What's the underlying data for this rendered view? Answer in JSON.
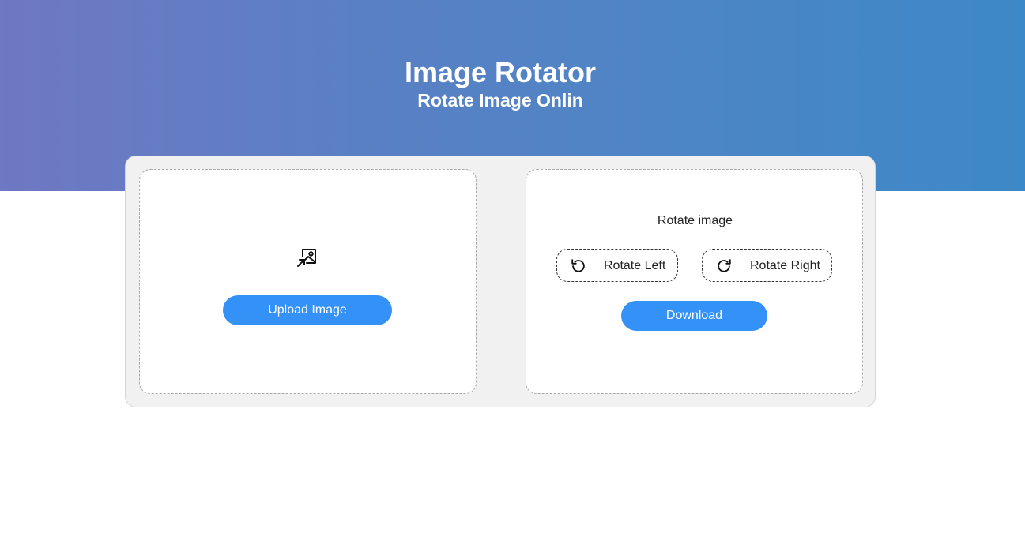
{
  "header": {
    "title": "Image Rotator",
    "subtitle": "Rotate Image Onlin"
  },
  "upload_card": {
    "icon": "image-upload-icon",
    "button_label": "Upload Image"
  },
  "rotate_card": {
    "heading": "Rotate image",
    "rotate_left": {
      "icon": "rotate-ccw-icon",
      "label": "Rotate Left"
    },
    "rotate_right": {
      "icon": "rotate-cw-icon",
      "label": "Rotate Right"
    },
    "download_label": "Download"
  },
  "colors": {
    "gradient_start": "#6f78c2",
    "gradient_end": "#3d88c8",
    "primary_button": "#3391f7",
    "panel_background": "#f1f1f1"
  }
}
